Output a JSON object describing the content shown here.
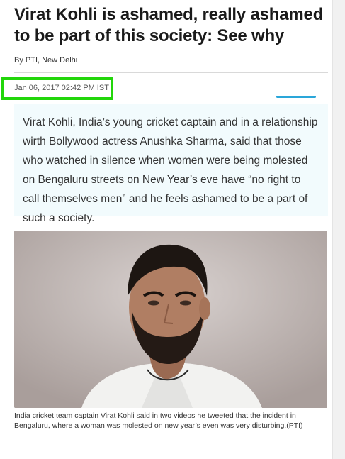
{
  "article": {
    "headline": "Virat Kohli is ashamed, really ashamed to be part of this society: See why",
    "byline": "By PTI, New Delhi",
    "date": "Jan 06, 2017 02:42 PM IST",
    "summary": "Virat Kohli, India’s young cricket captain and in a relationship wirth Bollywood actress Anushka Sharma, said that those who watched in silence when women were being molested on Bengaluru streets on New Year’s eve have “no right to call themselves men” and he feels ashamed to be a part of such a society.",
    "caption": "India cricket team captain Virat Kohli said in two videos he tweeted that the incident in Bengaluru, where a woman was molested on new year’s even was very disturbing.(PTI)"
  },
  "colors": {
    "highlight_box": "#22d60a",
    "summary_bg": "#f2fbfd",
    "share_accent": "#2aa6d9"
  }
}
